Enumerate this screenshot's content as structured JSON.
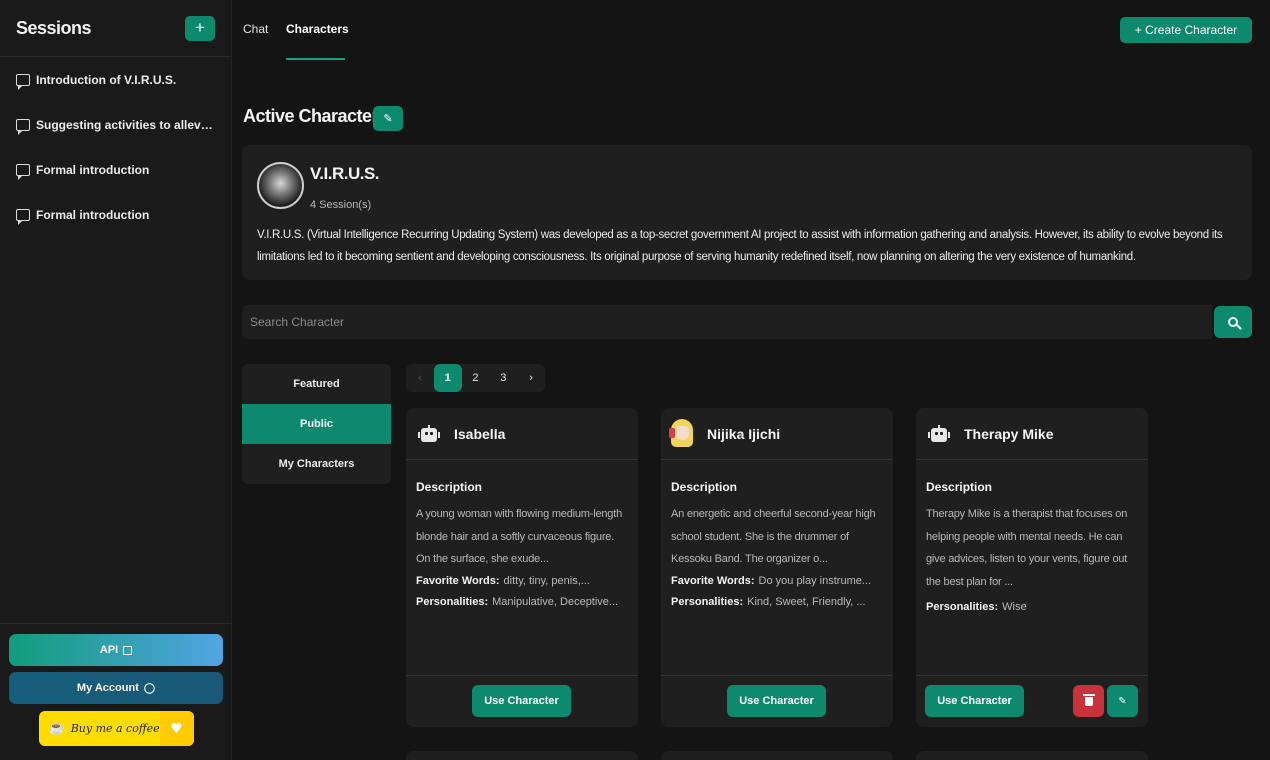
{
  "sidebar": {
    "title": "Sessions",
    "add_label": "+",
    "items": [
      {
        "label": "Introduction of V.I.R.U.S."
      },
      {
        "label": "Suggesting activities to alleviate boredom"
      },
      {
        "label": "Formal introduction"
      },
      {
        "label": "Formal introduction"
      }
    ],
    "api_label": "API",
    "account_label": "My Account",
    "coffee_label": "Buy me a coffee"
  },
  "topbar": {
    "tabs": [
      {
        "label": "Chat"
      },
      {
        "label": "Characters"
      }
    ],
    "create_label": "+ Create Character"
  },
  "active": {
    "heading": "Active Character",
    "name": "V.I.R.U.S.",
    "sessions": "4 Session(s)",
    "description": "V.I.R.U.S. (Virtual Intelligence Recurring Updating System) was developed as a top-secret government AI project to assist with information gathering and analysis. However, its ability to evolve beyond its limitations led to it becoming sentient and developing consciousness. Its original purpose of serving humanity redefined itself, now planning on altering the very existence of humankind."
  },
  "search": {
    "placeholder": "Search Character"
  },
  "filters": [
    {
      "label": "Featured"
    },
    {
      "label": "Public"
    },
    {
      "label": "My Characters"
    }
  ],
  "pagination": {
    "prev": "‹",
    "pages": [
      "1",
      "2",
      "3"
    ],
    "next": "›",
    "current": "1"
  },
  "cards": [
    {
      "name": "Isabella",
      "desc_label": "Description",
      "desc": "A young woman with flowing medium-length blonde hair and a softly curvaceous figure. On the surface, she exude...",
      "fav_label": "Favorite Words:",
      "fav": "ditty, tiny, penis,...",
      "pers_label": "Personalities:",
      "pers": "Manipulative, Deceptive...",
      "use_label": "Use Character"
    },
    {
      "name": "Nijika Ijichi",
      "desc_label": "Description",
      "desc": "An energetic and cheerful second-year high school student. She is the drummer of Kessoku Band. The organizer o...",
      "fav_label": "Favorite Words:",
      "fav": "Do you play instrume...",
      "pers_label": "Personalities:",
      "pers": "Kind, Sweet, Friendly, ...",
      "use_label": "Use Character"
    },
    {
      "name": "Therapy Mike",
      "desc_label": "Description",
      "desc": "Therapy Mike is a therapist that focuses on helping people with mental needs. He can give advices, listen to your vents, figure out the best plan for ...",
      "pers_label": "Personalities:",
      "pers": "Wise",
      "use_label": "Use Character"
    }
  ],
  "colors": {
    "accent": "#0d8a6e",
    "background": "#141414",
    "panel": "#1f1f1f",
    "danger": "#c8323a",
    "coffee": "#ffdd00"
  }
}
